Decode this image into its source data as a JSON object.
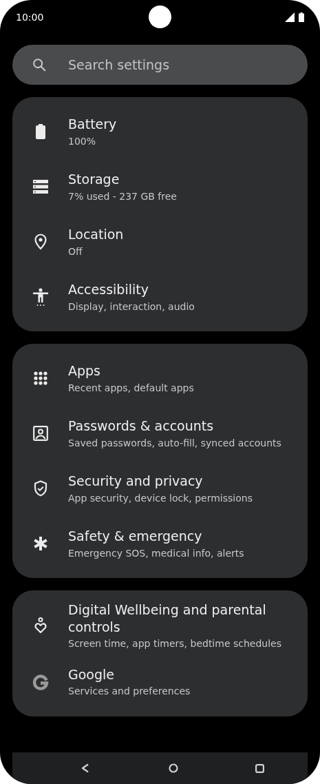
{
  "status_bar": {
    "time": "10:00"
  },
  "search": {
    "placeholder": "Search settings"
  },
  "groups": [
    {
      "items": [
        {
          "kind": "battery",
          "title": "Battery",
          "subtitle": "100%"
        },
        {
          "kind": "storage",
          "title": "Storage",
          "subtitle": "7% used - 237 GB free"
        },
        {
          "kind": "location",
          "title": "Location",
          "subtitle": "Off"
        },
        {
          "kind": "accessibility",
          "title": "Accessibility",
          "subtitle": "Display, interaction, audio"
        }
      ]
    },
    {
      "items": [
        {
          "kind": "apps",
          "title": "Apps",
          "subtitle": "Recent apps, default apps"
        },
        {
          "kind": "account",
          "title": "Passwords & accounts",
          "subtitle": "Saved passwords, auto-fill, synced accounts"
        },
        {
          "kind": "shield",
          "title": "Security and privacy",
          "subtitle": "App security, device lock, permissions"
        },
        {
          "kind": "asterisk",
          "title": "Safety & emergency",
          "subtitle": "Emergency SOS, medical info, alerts"
        }
      ]
    },
    {
      "items": [
        {
          "kind": "wellbeing",
          "title": "Digital Wellbeing and parental controls",
          "subtitle": "Screen time, app timers, bedtime schedules"
        },
        {
          "kind": "google",
          "title": "Google",
          "subtitle": "Services and preferences"
        }
      ]
    }
  ]
}
